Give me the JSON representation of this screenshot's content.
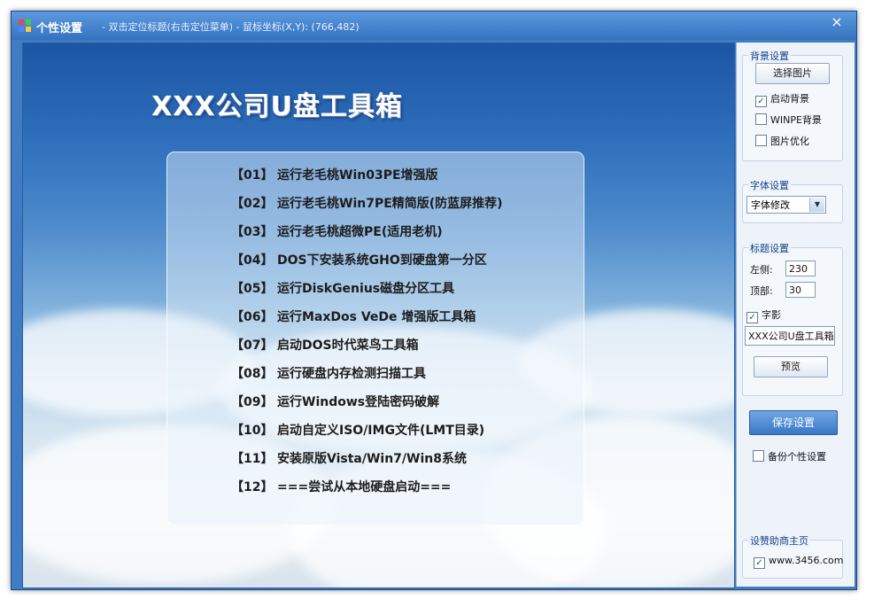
{
  "window": {
    "title": "个性设置",
    "subtitle": "- 双击定位标题(右击定位菜单) - 鼠标坐标(X,Y): (766,482)",
    "close_glyph": "×"
  },
  "preview": {
    "heading": "XXX公司U盘工具箱",
    "menu": [
      {
        "num": "【01】",
        "label": "运行老毛桃Win03PE增强版"
      },
      {
        "num": "【02】",
        "label": "运行老毛桃Win7PE精简版(防蓝屏推荐)"
      },
      {
        "num": "【03】",
        "label": "运行老毛桃超微PE(适用老机)"
      },
      {
        "num": "【04】",
        "label": "DOS下安装系统GHO到硬盘第一分区"
      },
      {
        "num": "【05】",
        "label": "运行DiskGenius磁盘分区工具"
      },
      {
        "num": "【06】",
        "label": "运行MaxDos VeDe 增强版工具箱"
      },
      {
        "num": "【07】",
        "label": "启动DOS时代菜鸟工具箱"
      },
      {
        "num": "【08】",
        "label": "运行硬盘内存检测扫描工具"
      },
      {
        "num": "【09】",
        "label": "运行Windows登陆密码破解"
      },
      {
        "num": "【10】",
        "label": "启动自定义ISO/IMG文件(LMT目录)"
      },
      {
        "num": "【11】",
        "label": "安装原版Vista/Win7/Win8系统"
      },
      {
        "num": "【12】",
        "label": "===尝试从本地硬盘启动==="
      }
    ]
  },
  "settings": {
    "background": {
      "group_title": "背景设置",
      "choose_image_label": "选择图片",
      "enable_bg": {
        "label": "启动背景",
        "checked": true
      },
      "winpe_bg": {
        "label": "WINPE背景",
        "checked": false
      },
      "image_opt": {
        "label": "图片优化",
        "checked": false
      }
    },
    "font": {
      "group_title": "字体设置",
      "selected": "字体修改"
    },
    "title": {
      "group_title": "标题设置",
      "left_label": "左侧:",
      "left_value": "230",
      "top_label": "顶部:",
      "top_value": "30",
      "shadow": {
        "label": "字影",
        "checked": true
      },
      "text_value": "XXX公司U盘工具箱",
      "preview_label": "预览"
    },
    "save_label": "保存设置",
    "backup": {
      "label": "备份个性设置",
      "checked": false
    },
    "sponsor": {
      "group_title": "设赞助商主页",
      "url": {
        "label": "www.3456.com",
        "checked": true
      }
    }
  },
  "colors": {
    "titlebar": "#3f7cc4",
    "primary_button": "#3a77c6",
    "group_title": "#15418a"
  }
}
